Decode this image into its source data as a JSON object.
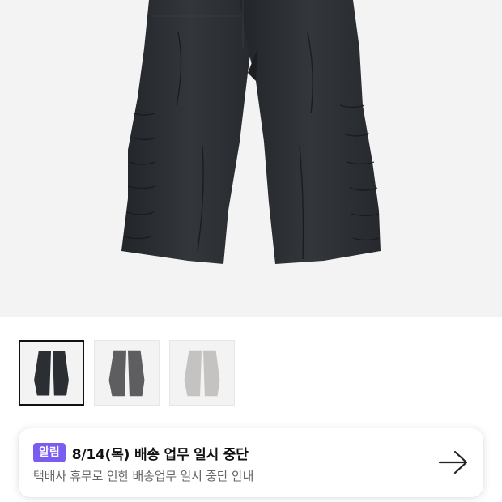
{
  "product": {
    "main_image": {
      "icon": "black-cargo-pants-photo",
      "color": "#2b2e33"
    },
    "thumbnails": [
      {
        "icon": "black-pants-thumbnail",
        "color": "#2b2e33",
        "selected": true
      },
      {
        "icon": "gray-pants-thumbnail",
        "color": "#5e5e60",
        "selected": false
      },
      {
        "icon": "light-gray-pants-thumbnail",
        "color": "#c5c3c1",
        "selected": false
      }
    ]
  },
  "notice": {
    "badge": "알림",
    "title": "8/14(목) 배송 업무 일시 중단",
    "subtitle": "택배사 휴무로 인한 배송업무 일시 중단 안내",
    "arrow_icon": "arrow-right-icon",
    "badge_color": "#7a5cf0"
  }
}
